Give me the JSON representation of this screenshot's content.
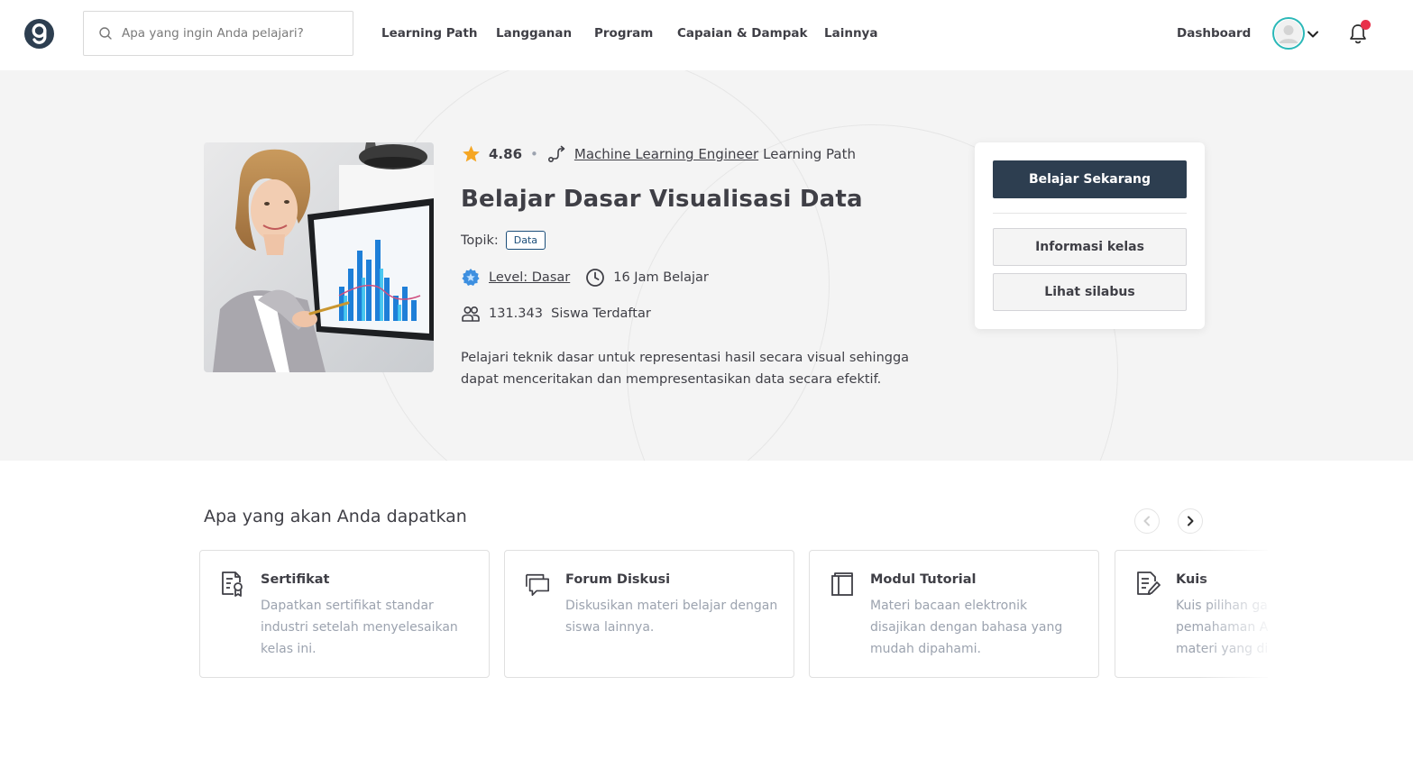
{
  "header": {
    "search_placeholder": "Apa yang ingin Anda pelajari?",
    "nav": [
      "Learning Path",
      "Langganan",
      "Program",
      "Capaian & Dampak",
      "Lainnya"
    ],
    "dashboard_label": "Dashboard"
  },
  "course": {
    "rating": "4.86",
    "rating_separator": "•",
    "learning_path_name": "Machine Learning Engineer",
    "learning_path_suffix": "Learning Path",
    "title": "Belajar Dasar Visualisasi Data",
    "topic_label": "Topik:",
    "topic_tag": "Data",
    "level": "Level: Dasar",
    "duration": "16 Jam Belajar",
    "students": "131.343  Siswa Terdaftar",
    "description": "Pelajari teknik dasar untuk representasi hasil secara visual sehingga dapat menceritakan dan mempresentasikan data secara efektif."
  },
  "cta": {
    "primary": "Belajar Sekarang",
    "info": "Informasi kelas",
    "syllabus": "Lihat silabus"
  },
  "benefits": {
    "title": "Apa yang akan Anda dapatkan",
    "cards": [
      {
        "icon": "certificate-icon",
        "title": "Sertifikat",
        "desc": "Dapatkan sertifikat standar industri setelah menyelesaikan kelas ini."
      },
      {
        "icon": "forum-icon",
        "title": "Forum Diskusi",
        "desc": "Diskusikan materi belajar dengan siswa lainnya."
      },
      {
        "icon": "module-icon",
        "title": "Modul Tutorial",
        "desc": "Materi bacaan elektronik disajikan dengan bahasa yang mudah dipahami."
      },
      {
        "icon": "quiz-icon",
        "title": "Kuis",
        "desc": "Kuis pilihan ganda untuk menguji pemahaman Anda memahami materi yang dipelajari."
      }
    ]
  },
  "colors": {
    "primary_button": "#2d3e50",
    "star": "#f5a623",
    "notification_dot": "#e8314a",
    "avatar_ring": "#2bb8b8",
    "tag_border": "#1b4e7a"
  }
}
